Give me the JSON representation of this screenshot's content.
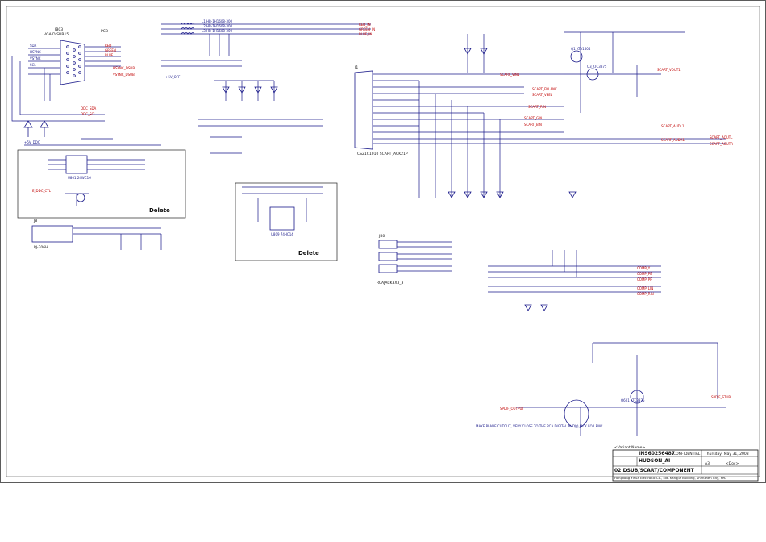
{
  "title_block": {
    "part_number": "INS60256487",
    "confidential": "CONFIDENTIAL",
    "title": "HUDSON_AI",
    "subtitle": "02.DSUB/SCART/COMPONENT",
    "date": "Thursday, May 31, 2008",
    "size": "A3",
    "doc_number": "<Doc>",
    "variant": "<Variant Name>",
    "company": "Hongkong Yihua Electronic Co., Ltd. Kangjia Building, Shenzhen City, PRC"
  },
  "connectors": {
    "vga": "VGA-D-SUB15",
    "vga_ref": "JB03",
    "pcb": "PCB",
    "scart": "CS21C1010 SCART JACK21P",
    "scart_ref": "J1",
    "rca_jack": "RCAJACK3X3_3",
    "rca_ref": "JB0",
    "phone_jack": "PJ-306H",
    "phone_ref": "J8"
  },
  "left_labels": [
    "SDA",
    "HSYNC",
    "VSYNC",
    "SCL",
    "DDC_SDA",
    "DDC_SCL",
    "+5V_DDC",
    "E_DDC_CTL"
  ],
  "top_nets": [
    "RED",
    "GREEN",
    "BLUE",
    "HSYNC_DSUB",
    "VSYNC_DSUB",
    "+5V_OFF"
  ],
  "rgb_filters": [
    "L1 HB-1H1608-300",
    "L2 HB-1H1608-300",
    "L3 HB-1H1608-300"
  ],
  "rgb_outputs": [
    "RED_IN",
    "GREEN_IN",
    "BLUE_IN"
  ],
  "scart_nets": [
    "SCART_VIN1",
    "SCART_FBLANK",
    "SCART_VSEL",
    "SCART_RIN",
    "SCART_GIN",
    "SCART_BIN",
    "SCART_AUDL1",
    "SCART_AUDR1",
    "SCART_AOUTL",
    "SCART_AOUTR",
    "SCART_VOUT1"
  ],
  "comp_nets": [
    "COMP_Y",
    "COMP_PB",
    "COMP_PR",
    "COMP_LIN",
    "COMP_RIN",
    "SPDIF_OUT"
  ],
  "ic_labels": [
    "U801 24WC16",
    "U809 74HC14"
  ],
  "delete_boxes": [
    "Delete",
    "Delete"
  ],
  "spdif": {
    "label": "SPDIF_OUTPUT",
    "out": "SPDIF_STUB",
    "transistor": "KTC3875"
  },
  "transistors": [
    "Q1 KTA1504",
    "Q3 KTC3875",
    "Q601 KTC3875"
  ],
  "bottom_note": "MAKE PLANE CUTOUT, VERY CLOSE TO THE RCA DIGITAL AUDIO JACK FOR EMC"
}
